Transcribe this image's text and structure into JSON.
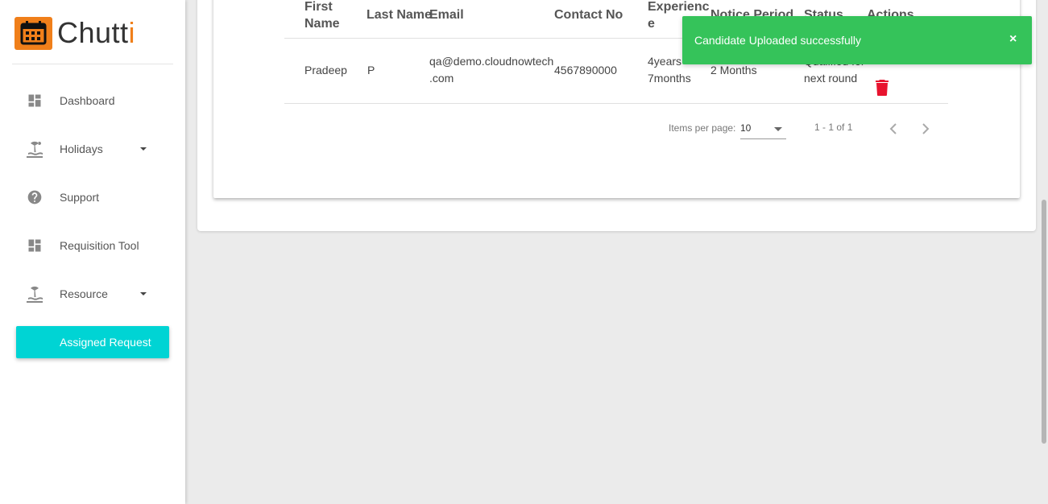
{
  "brand": {
    "name": "Chutt",
    "accent_letter": "i"
  },
  "sidebar": {
    "items": [
      {
        "label": "Dashboard",
        "icon": "dashboard-icon"
      },
      {
        "label": "Holidays",
        "icon": "beach-icon",
        "has_dropdown": true
      },
      {
        "label": "Support",
        "icon": "help-icon"
      },
      {
        "label": "Requisition Tool",
        "icon": "dashboard-icon"
      },
      {
        "label": "Resource",
        "icon": "beach-icon",
        "has_dropdown": true
      },
      {
        "label": "Assigned Request",
        "active": true
      }
    ]
  },
  "table": {
    "headers": {
      "first_name_1": "First",
      "first_name_2": "Name",
      "last_name": "Last Name",
      "email": "Email",
      "contact": "Contact No",
      "experience_1": "Experienc",
      "experience_2": "e",
      "notice": "Notice Period",
      "status": "Status",
      "actions": "Actions"
    },
    "rows": [
      {
        "first_name": "Pradeep",
        "last_name": "P",
        "email_1": "qa@demo.cloudnowtech",
        "email_2": ".com",
        "contact": "4567890000",
        "experience_1": "4years",
        "experience_2": "7months",
        "notice": "2 Months",
        "status_1": "Qualified for",
        "status_2": "next round"
      }
    ]
  },
  "pagination": {
    "items_per_page_label": "Items per page:",
    "items_per_page_value": "10",
    "range": "1 - 1 of 1"
  },
  "toast": {
    "message": "Candidate Uploaded successfully",
    "close_label": "×"
  },
  "colors": {
    "accent": "#00d4d4",
    "brand_orange": "#f07f1a",
    "toast_green": "#35c35a",
    "delete_red": "#e8132e"
  }
}
